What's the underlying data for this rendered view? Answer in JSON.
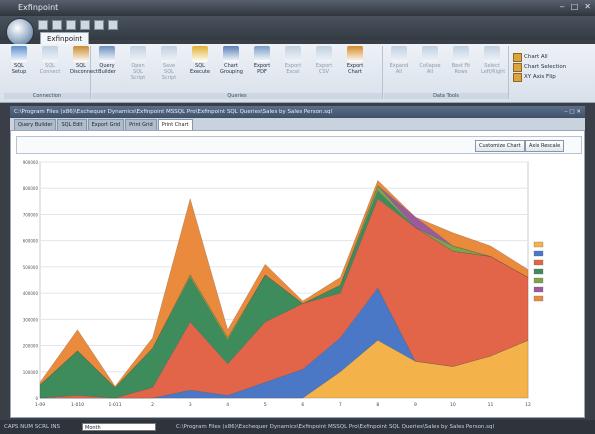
{
  "window": {
    "title": "Exfinpoint"
  },
  "ribbon": {
    "tab": "Exfinpoint",
    "groups": [
      {
        "label": "Connection",
        "buttons": [
          {
            "label": "SQL Setup",
            "enabled": true,
            "color": "#5b8fd0"
          },
          {
            "label": "SQL Connect",
            "enabled": false,
            "color": "#8aa7c6"
          },
          {
            "label": "SQL Disconnect",
            "enabled": true,
            "color": "#c98d2e"
          }
        ]
      },
      {
        "label": "Queries",
        "buttons": [
          {
            "label": "Query Builder",
            "enabled": true,
            "color": "#6c8fbf"
          },
          {
            "label": "Open SQL Script",
            "enabled": false,
            "color": "#8aa7c6"
          },
          {
            "label": "Save SQL Script",
            "enabled": false,
            "color": "#8aa7c6"
          },
          {
            "label": "SQL Execute",
            "enabled": true,
            "color": "#e0b030"
          },
          {
            "label": "Chart Grouping",
            "enabled": true,
            "color": "#5a7fb8"
          },
          {
            "label": "Export PDF",
            "enabled": true,
            "color": "#7a9cc8"
          },
          {
            "label": "Export Excel",
            "enabled": false,
            "color": "#8aa7c6"
          },
          {
            "label": "Export CSV",
            "enabled": false,
            "color": "#8aa7c6"
          },
          {
            "label": "Export Chart",
            "enabled": true,
            "color": "#d48a2a"
          }
        ]
      },
      {
        "label": "Data Tools",
        "buttons": [
          {
            "label": "Expand All",
            "enabled": false,
            "color": "#8aa7c6"
          },
          {
            "label": "Collapse All",
            "enabled": false,
            "color": "#8aa7c6"
          },
          {
            "label": "Best Fit Rows",
            "enabled": false,
            "color": "#8aa7c6"
          },
          {
            "label": "Select Left/Right",
            "enabled": false,
            "color": "#8aa7c6"
          }
        ]
      }
    ],
    "small_buttons": [
      "Chart All",
      "Chart Selection",
      "XY Axis Flip"
    ]
  },
  "document": {
    "path": "C:\\Program Files (x86)\\Exchequer Dynamics\\Exfinpoint MSSQL Pro\\Exfinpoint SQL Queries\\Sales by Sales Person.sql",
    "tabs": [
      "Query Builder",
      "SQL Edit",
      "Export Grid",
      "Print Grid",
      "Print Chart"
    ],
    "active_tab": "Print Chart",
    "toolbar": {
      "customize_label": "Customize Chart",
      "axis_label": "Axis Rescale"
    }
  },
  "status": {
    "left": "CAPS NUM SCRL INS",
    "input": "Month",
    "path": "C:\\Program Files (x86)\\Exchequer Dynamics\\Exfinpoint MSSQL Pro\\Exfinpoint SQL Queries\\Sales by Sales Person.sql"
  },
  "chart_data": {
    "type": "area",
    "stacked": true,
    "categories": [
      "1-09",
      "1-010",
      "1-011",
      "2",
      "3",
      "4",
      "5",
      "6",
      "7",
      "8",
      "9",
      "10",
      "11",
      "12"
    ],
    "ylim": [
      0,
      900000
    ],
    "yticks": [
      0,
      100000,
      200000,
      300000,
      400000,
      500000,
      600000,
      700000,
      800000,
      900000
    ],
    "grid": true,
    "legend_position": "right",
    "series": [
      {
        "color": "#f4b24a",
        "values": [
          0,
          0,
          0,
          0,
          0,
          0,
          0,
          0,
          100000,
          220000,
          140000,
          120000,
          160000,
          220000
        ]
      },
      {
        "color": "#4a78c6",
        "values": [
          0,
          0,
          0,
          0,
          30000,
          10000,
          60000,
          110000,
          130000,
          200000,
          0,
          0,
          0,
          0
        ]
      },
      {
        "color": "#e2654a",
        "values": [
          0,
          10000,
          0,
          40000,
          260000,
          120000,
          230000,
          250000,
          170000,
          340000,
          510000,
          440000,
          380000,
          240000
        ]
      },
      {
        "color": "#3e8c5c",
        "values": [
          50000,
          170000,
          40000,
          150000,
          170000,
          90000,
          180000,
          0,
          30000,
          30000,
          0,
          0,
          0,
          0
        ]
      },
      {
        "color": "#7ea34a",
        "values": [
          0,
          0,
          0,
          0,
          10000,
          10000,
          0,
          0,
          0,
          20000,
          0,
          20000,
          0,
          0
        ]
      },
      {
        "color": "#9c5a9c",
        "values": [
          0,
          0,
          0,
          0,
          0,
          0,
          0,
          0,
          0,
          0,
          40000,
          0,
          0,
          0
        ]
      },
      {
        "color": "#e98a3c",
        "values": [
          10000,
          80000,
          5000,
          40000,
          290000,
          30000,
          40000,
          10000,
          30000,
          20000,
          0,
          50000,
          40000,
          30000
        ]
      }
    ]
  }
}
